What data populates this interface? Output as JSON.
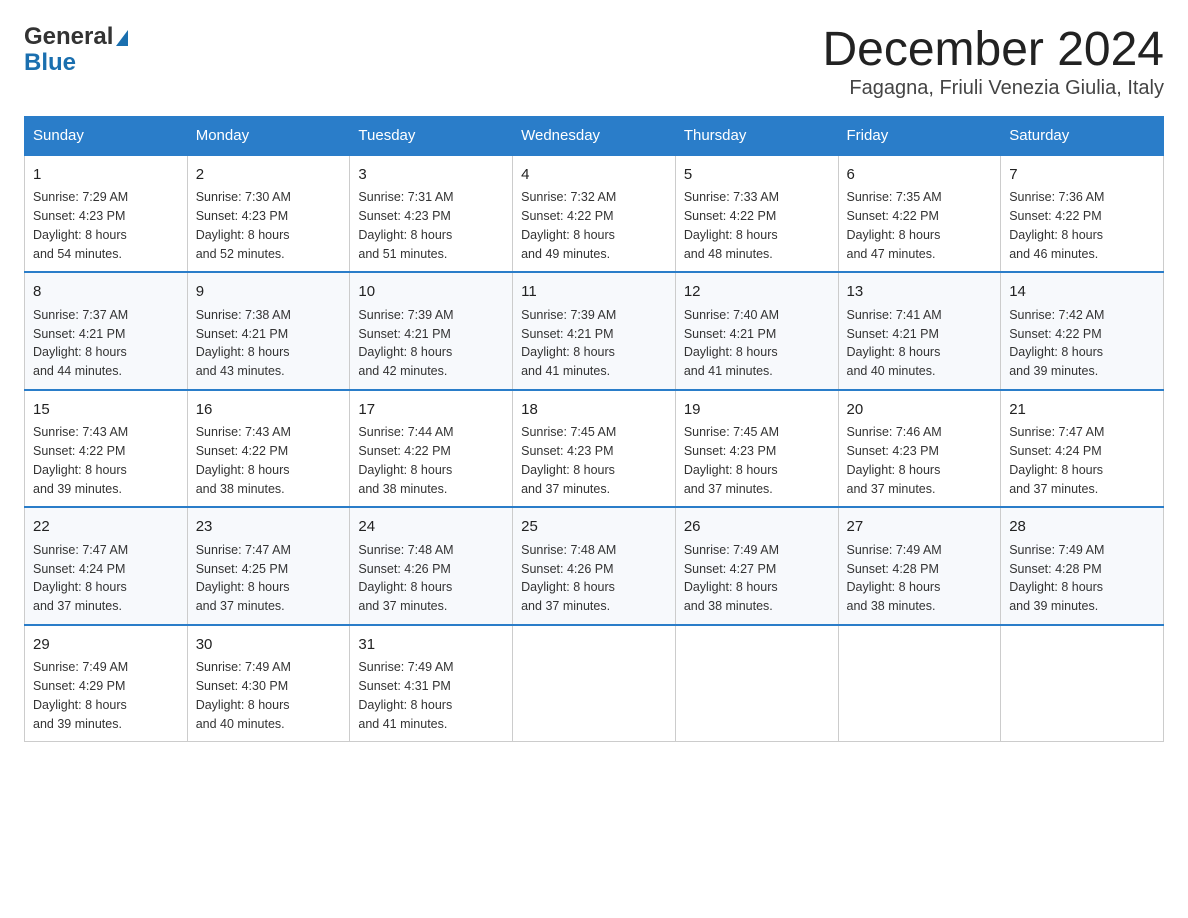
{
  "logo": {
    "line1": "General",
    "triangle": "▶",
    "line2": "Blue"
  },
  "title": "December 2024",
  "subtitle": "Fagagna, Friuli Venezia Giulia, Italy",
  "weekdays": [
    "Sunday",
    "Monday",
    "Tuesday",
    "Wednesday",
    "Thursday",
    "Friday",
    "Saturday"
  ],
  "weeks": [
    [
      {
        "day": "1",
        "sunrise": "7:29 AM",
        "sunset": "4:23 PM",
        "daylight": "8 hours and 54 minutes."
      },
      {
        "day": "2",
        "sunrise": "7:30 AM",
        "sunset": "4:23 PM",
        "daylight": "8 hours and 52 minutes."
      },
      {
        "day": "3",
        "sunrise": "7:31 AM",
        "sunset": "4:23 PM",
        "daylight": "8 hours and 51 minutes."
      },
      {
        "day": "4",
        "sunrise": "7:32 AM",
        "sunset": "4:22 PM",
        "daylight": "8 hours and 49 minutes."
      },
      {
        "day": "5",
        "sunrise": "7:33 AM",
        "sunset": "4:22 PM",
        "daylight": "8 hours and 48 minutes."
      },
      {
        "day": "6",
        "sunrise": "7:35 AM",
        "sunset": "4:22 PM",
        "daylight": "8 hours and 47 minutes."
      },
      {
        "day": "7",
        "sunrise": "7:36 AM",
        "sunset": "4:22 PM",
        "daylight": "8 hours and 46 minutes."
      }
    ],
    [
      {
        "day": "8",
        "sunrise": "7:37 AM",
        "sunset": "4:21 PM",
        "daylight": "8 hours and 44 minutes."
      },
      {
        "day": "9",
        "sunrise": "7:38 AM",
        "sunset": "4:21 PM",
        "daylight": "8 hours and 43 minutes."
      },
      {
        "day": "10",
        "sunrise": "7:39 AM",
        "sunset": "4:21 PM",
        "daylight": "8 hours and 42 minutes."
      },
      {
        "day": "11",
        "sunrise": "7:39 AM",
        "sunset": "4:21 PM",
        "daylight": "8 hours and 41 minutes."
      },
      {
        "day": "12",
        "sunrise": "7:40 AM",
        "sunset": "4:21 PM",
        "daylight": "8 hours and 41 minutes."
      },
      {
        "day": "13",
        "sunrise": "7:41 AM",
        "sunset": "4:21 PM",
        "daylight": "8 hours and 40 minutes."
      },
      {
        "day": "14",
        "sunrise": "7:42 AM",
        "sunset": "4:22 PM",
        "daylight": "8 hours and 39 minutes."
      }
    ],
    [
      {
        "day": "15",
        "sunrise": "7:43 AM",
        "sunset": "4:22 PM",
        "daylight": "8 hours and 39 minutes."
      },
      {
        "day": "16",
        "sunrise": "7:43 AM",
        "sunset": "4:22 PM",
        "daylight": "8 hours and 38 minutes."
      },
      {
        "day": "17",
        "sunrise": "7:44 AM",
        "sunset": "4:22 PM",
        "daylight": "8 hours and 38 minutes."
      },
      {
        "day": "18",
        "sunrise": "7:45 AM",
        "sunset": "4:23 PM",
        "daylight": "8 hours and 37 minutes."
      },
      {
        "day": "19",
        "sunrise": "7:45 AM",
        "sunset": "4:23 PM",
        "daylight": "8 hours and 37 minutes."
      },
      {
        "day": "20",
        "sunrise": "7:46 AM",
        "sunset": "4:23 PM",
        "daylight": "8 hours and 37 minutes."
      },
      {
        "day": "21",
        "sunrise": "7:47 AM",
        "sunset": "4:24 PM",
        "daylight": "8 hours and 37 minutes."
      }
    ],
    [
      {
        "day": "22",
        "sunrise": "7:47 AM",
        "sunset": "4:24 PM",
        "daylight": "8 hours and 37 minutes."
      },
      {
        "day": "23",
        "sunrise": "7:47 AM",
        "sunset": "4:25 PM",
        "daylight": "8 hours and 37 minutes."
      },
      {
        "day": "24",
        "sunrise": "7:48 AM",
        "sunset": "4:26 PM",
        "daylight": "8 hours and 37 minutes."
      },
      {
        "day": "25",
        "sunrise": "7:48 AM",
        "sunset": "4:26 PM",
        "daylight": "8 hours and 37 minutes."
      },
      {
        "day": "26",
        "sunrise": "7:49 AM",
        "sunset": "4:27 PM",
        "daylight": "8 hours and 38 minutes."
      },
      {
        "day": "27",
        "sunrise": "7:49 AM",
        "sunset": "4:28 PM",
        "daylight": "8 hours and 38 minutes."
      },
      {
        "day": "28",
        "sunrise": "7:49 AM",
        "sunset": "4:28 PM",
        "daylight": "8 hours and 39 minutes."
      }
    ],
    [
      {
        "day": "29",
        "sunrise": "7:49 AM",
        "sunset": "4:29 PM",
        "daylight": "8 hours and 39 minutes."
      },
      {
        "day": "30",
        "sunrise": "7:49 AM",
        "sunset": "4:30 PM",
        "daylight": "8 hours and 40 minutes."
      },
      {
        "day": "31",
        "sunrise": "7:49 AM",
        "sunset": "4:31 PM",
        "daylight": "8 hours and 41 minutes."
      },
      null,
      null,
      null,
      null
    ]
  ],
  "labels": {
    "sunrise_prefix": "Sunrise: ",
    "sunset_prefix": "Sunset: ",
    "daylight_prefix": "Daylight: "
  }
}
